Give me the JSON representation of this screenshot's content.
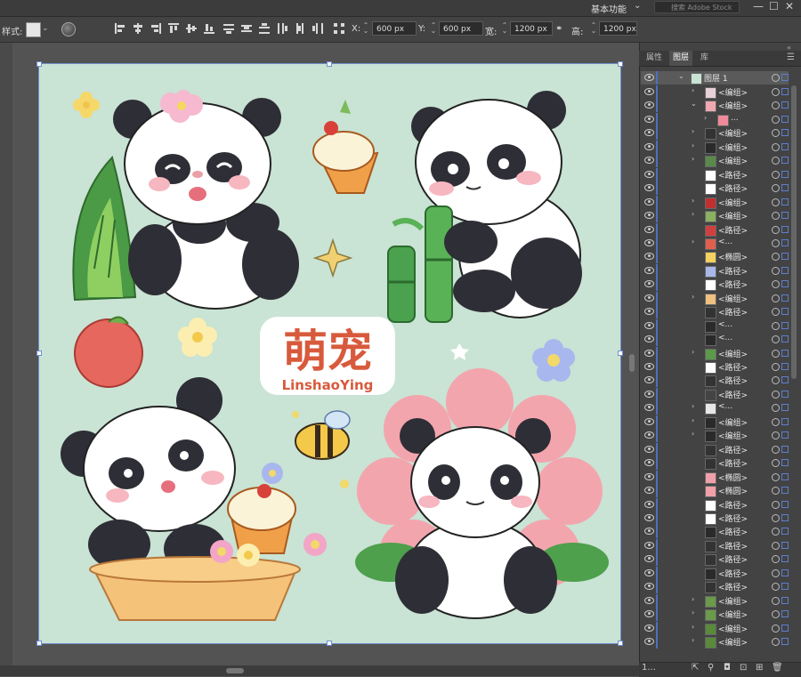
{
  "topbar": {
    "workspace": "基本功能",
    "search_placeholder": "搜索 Adobe Stock",
    "win_min": "—",
    "win_max": "☐",
    "win_close": "✕"
  },
  "controlbar": {
    "style_label": "样式:",
    "x_label": "X:",
    "x_value": "600 px",
    "y_label": "Y:",
    "y_value": "600 px",
    "w_label": "宽:",
    "w_value": "1200 px",
    "h_label": "高:",
    "h_value": "1200 px"
  },
  "panel": {
    "tabs": [
      "属性",
      "图层",
      "库"
    ],
    "active_tab": "图层",
    "top_layer": "图层 1",
    "layers": [
      {
        "name": "<编组>",
        "depth": 1,
        "expand": "closed",
        "color": "#e8d0d8"
      },
      {
        "name": "<编组>",
        "depth": 1,
        "expand": "open",
        "color": "#f0a8b0"
      },
      {
        "name": "...",
        "depth": 2,
        "expand": "closed",
        "color": "#f08a9a"
      },
      {
        "name": "<编组>",
        "depth": 1,
        "expand": "closed",
        "color": "#333333"
      },
      {
        "name": "<编组>",
        "depth": 1,
        "expand": "closed",
        "color": "#2a2a2a"
      },
      {
        "name": "<编组>",
        "depth": 1,
        "expand": "closed",
        "color": "#5a8a4a"
      },
      {
        "name": "<路径>",
        "depth": 1,
        "expand": "none",
        "color": "#ffffff"
      },
      {
        "name": "<路径>",
        "depth": 1,
        "expand": "none",
        "color": "#ffffff"
      },
      {
        "name": "<编组>",
        "depth": 1,
        "expand": "closed",
        "color": "#c03030"
      },
      {
        "name": "<编组>",
        "depth": 1,
        "expand": "closed",
        "color": "#8ab060"
      },
      {
        "name": "<路径>",
        "depth": 1,
        "expand": "none",
        "color": "#d04040"
      },
      {
        "name": "<...",
        "depth": 1,
        "expand": "closed",
        "color": "#e06050"
      },
      {
        "name": "<椭圆>",
        "depth": 1,
        "expand": "none",
        "color": "#f4d060"
      },
      {
        "name": "<路径>",
        "depth": 1,
        "expand": "none",
        "color": "#a8b8e8"
      },
      {
        "name": "<路径>",
        "depth": 1,
        "expand": "none",
        "color": "#ffffff"
      },
      {
        "name": "<编组>",
        "depth": 1,
        "expand": "closed",
        "color": "#f0c080"
      },
      {
        "name": "<路径>",
        "depth": 1,
        "expand": "none",
        "color": "#333333"
      },
      {
        "name": "<...",
        "depth": 1,
        "expand": "none",
        "color": "#2a2a2a"
      },
      {
        "name": "<...",
        "depth": 1,
        "expand": "none",
        "color": "#2a2a2a"
      },
      {
        "name": "<编组>",
        "depth": 1,
        "expand": "closed",
        "color": "#5a9a4a"
      },
      {
        "name": "<路径>",
        "depth": 1,
        "expand": "none",
        "color": "#ffffff"
      },
      {
        "name": "<路径>",
        "depth": 1,
        "expand": "none",
        "color": "#333333"
      },
      {
        "name": "<路径>",
        "depth": 1,
        "expand": "none",
        "color": "#444444"
      },
      {
        "name": "<...",
        "depth": 1,
        "expand": "closed",
        "color": "#e8e8e8"
      },
      {
        "name": "<编组>",
        "depth": 1,
        "expand": "closed",
        "color": "#2a2a2a"
      },
      {
        "name": "<编组>",
        "depth": 1,
        "expand": "closed",
        "color": "#2a2a2a"
      },
      {
        "name": "<路径>",
        "depth": 1,
        "expand": "none",
        "color": "#333333"
      },
      {
        "name": "<路径>",
        "depth": 1,
        "expand": "none",
        "color": "#333333"
      },
      {
        "name": "<椭圆>",
        "depth": 1,
        "expand": "none",
        "color": "#f0a0a8"
      },
      {
        "name": "<椭圆>",
        "depth": 1,
        "expand": "none",
        "color": "#f0a0a8"
      },
      {
        "name": "<路径>",
        "depth": 1,
        "expand": "none",
        "color": "#ffffff"
      },
      {
        "name": "<路径>",
        "depth": 1,
        "expand": "none",
        "color": "#ffffff"
      },
      {
        "name": "<路径>",
        "depth": 1,
        "expand": "none",
        "color": "#2a2a2a"
      },
      {
        "name": "<路径>",
        "depth": 1,
        "expand": "none",
        "color": "#333333"
      },
      {
        "name": "<路径>",
        "depth": 1,
        "expand": "none",
        "color": "#333333"
      },
      {
        "name": "<路径>",
        "depth": 1,
        "expand": "none",
        "color": "#2a2a2a"
      },
      {
        "name": "<路径>",
        "depth": 1,
        "expand": "none",
        "color": "#333333"
      },
      {
        "name": "<编组>",
        "depth": 1,
        "expand": "closed",
        "color": "#6a9a4a"
      },
      {
        "name": "<编组>",
        "depth": 1,
        "expand": "closed",
        "color": "#6a9a4a"
      },
      {
        "name": "<编组>",
        "depth": 1,
        "expand": "closed",
        "color": "#5a8a3a"
      },
      {
        "name": "<编组>",
        "depth": 1,
        "expand": "closed",
        "color": "#5a8a3a"
      }
    ],
    "footer_count": "1..."
  },
  "artwork": {
    "title_cn": "萌宠",
    "title_en": "LinshaoYing",
    "background": "#c9e3d4"
  }
}
